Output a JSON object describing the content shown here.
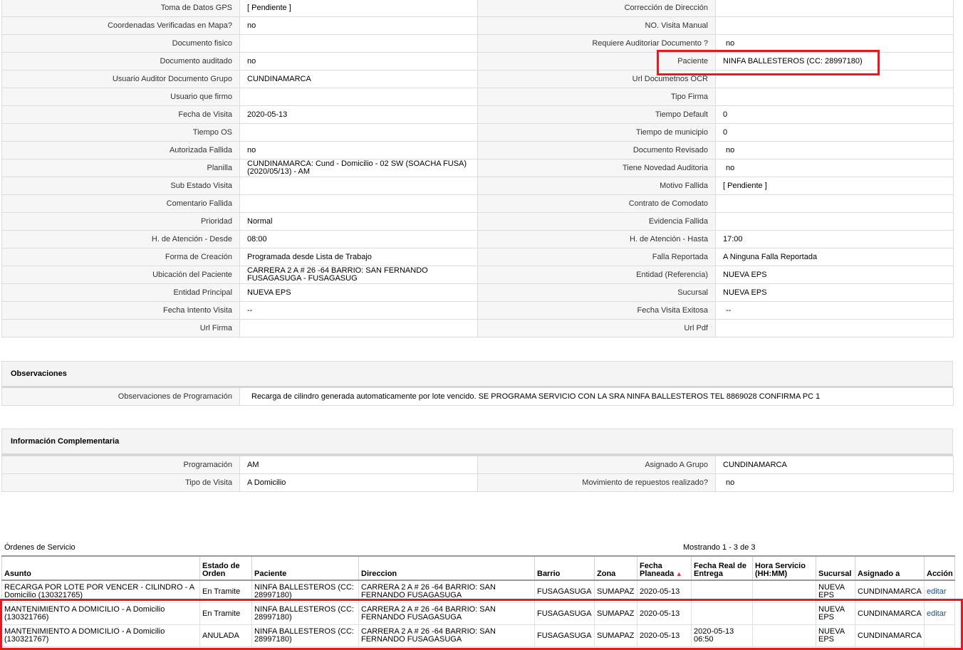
{
  "details": [
    [
      "Toma de Datos GPS",
      "[ Pendiente ]",
      "Corrección de Dirección",
      ""
    ],
    [
      "Coordenadas Verificadas en Mapa?",
      "no",
      "NO. Visita Manual",
      ""
    ],
    [
      "Documento fisico",
      "",
      "Requiere Auditoriar Documento ?",
      "no"
    ],
    [
      "Documento auditado",
      "no",
      "Paciente",
      "NINFA BALLESTEROS (CC: 28997180)"
    ],
    [
      "Usuario Auditor Documento Grupo",
      "CUNDINAMARCA",
      "Url Documetnos OCR",
      ""
    ],
    [
      "Usuario que firmo",
      "",
      "Tipo Firma",
      ""
    ],
    [
      "Fecha de Visita",
      "2020-05-13",
      "Tiempo Default",
      "0"
    ],
    [
      "Tiempo OS",
      "",
      "Tiempo de municipio",
      "0"
    ],
    [
      "Autorizada Fallida",
      "no",
      "Documento Revisado",
      "no"
    ],
    [
      "Planilla",
      "CUNDINAMARCA: Cund - Domicilio - 02 SW (SOACHA FUSA)\n(2020/05/13) - AM",
      "Tiene Novedad Auditoria",
      "no"
    ],
    [
      "Sub Estado Visita",
      "",
      "Motivo Fallida",
      "[ Pendiente ]"
    ],
    [
      "Comentario Fallida",
      "",
      "Contrato de Comodato",
      ""
    ],
    [
      "Prioridad",
      "Normal",
      "Evidencia Fallida",
      ""
    ],
    [
      "H. de Atención - Desde",
      "08:00",
      "H. de Atención - Hasta",
      "17:00"
    ],
    [
      "Forma de Creación",
      "Programada desde Lista de Trabajo",
      "Falla Reportada",
      "A Ninguna Falla Reportada"
    ],
    [
      "Ubicación del Paciente",
      "CARRERA 2 A # 26 -64 BARRIO: SAN FERNANDO\nFUSAGASUGA - FUSAGASUG",
      "Entidad (Referencia)",
      "NUEVA EPS"
    ],
    [
      "Entidad Principal",
      "NUEVA EPS",
      "Sucursal",
      "NUEVA EPS"
    ],
    [
      "Fecha Intento Visita",
      "--",
      "Fecha Visita Exitosa",
      "--"
    ],
    [
      "Url Firma",
      "",
      "Url Pdf",
      ""
    ]
  ],
  "observaciones": {
    "title": "Observaciones",
    "label": "Observaciones de Programación",
    "value": "Recarga de cilindro generada automaticamente por lote vencido. SE PROGRAMA SERVICIO CON LA SRA NINFA BALLESTEROS TEL 8869028 CONFIRMA PC 1"
  },
  "complementaria": {
    "title": "Información Complementaria",
    "rows": [
      [
        "Programación",
        "AM",
        "Asignado A Grupo",
        "CUNDINAMARCA"
      ],
      [
        "Tipo de Visita",
        "A Domicilio",
        "Movimiento de repuestos realizado?",
        "no"
      ]
    ]
  },
  "orders": {
    "title": "Órdenes de Servicio",
    "count": "Mostrando 1 - 3 de 3",
    "sort_icon": "sort-up-triangle-icon",
    "columns": [
      "Asunto",
      "Estado de Orden",
      "Paciente",
      "Direccion",
      "Barrio",
      "Zona",
      "Fecha Planeada",
      "Fecha Real de Entrega",
      "Hora Servicio (HH:MM)",
      "Sucursal",
      "Asignado a",
      "Acción"
    ],
    "rows": [
      [
        "RECARGA POR LOTE POR VENCER - CILINDRO - A Domicilio (130321765)",
        "En Tramite",
        "NINFA BALLESTEROS (CC: 28997180)",
        "CARRERA 2 A # 26 -64 BARRIO: SAN FERNANDO FUSAGASUGA",
        "FUSAGASUGA",
        "SUMAPAZ",
        "2020-05-13",
        "",
        "",
        "NUEVA EPS",
        "CUNDINAMARCA",
        "editar"
      ],
      [
        "MANTENIMIENTO A DOMICILIO - A Domicilio (130321766)",
        "En Tramite",
        "NINFA BALLESTEROS (CC: 28997180)",
        "CARRERA 2 A # 26 -64 BARRIO: SAN FERNANDO FUSAGASUGA",
        "FUSAGASUGA",
        "SUMAPAZ",
        "2020-05-13",
        "",
        "",
        "NUEVA EPS",
        "CUNDINAMARCA",
        "editar"
      ],
      [
        "MANTENIMIENTO A DOMICILIO - A Domicilio (130321767)",
        "ANULADA",
        "NINFA BALLESTEROS (CC: 28997180)",
        "CARRERA 2 A # 26 -64 BARRIO: SAN FERNANDO FUSAGASUGA",
        "FUSAGASUGA",
        "SUMAPAZ",
        "2020-05-13",
        "2020-05-13 06:50",
        "",
        "NUEVA EPS",
        "CUNDINAMARCA",
        ""
      ]
    ]
  },
  "colors": {
    "highlight": "#e01b24",
    "link": "#1a4f8a",
    "sort_arrow": "#d33333"
  }
}
